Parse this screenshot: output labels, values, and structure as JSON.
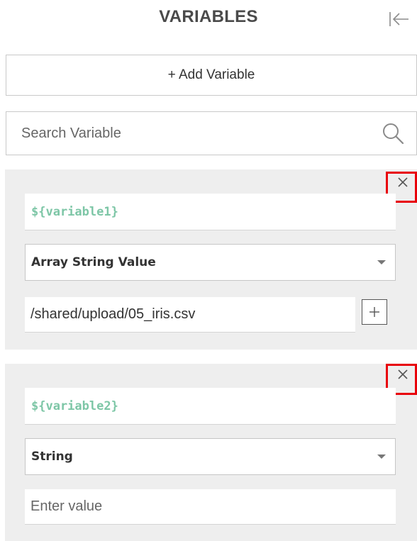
{
  "header": {
    "title": "VARIABLES",
    "collapse_icon": "collapse-left-icon"
  },
  "toolbar": {
    "add_label": "+ Add Variable"
  },
  "search": {
    "placeholder": "Search Variable",
    "value": "",
    "icon": "search-icon"
  },
  "variables": [
    {
      "name": "${variable1}",
      "type": "Array String Value",
      "value": "/shared/upload/05_iris.csv",
      "placeholder": "",
      "has_add_value": true
    },
    {
      "name": "${variable2}",
      "type": "String",
      "value": "",
      "placeholder": "Enter value",
      "has_add_value": false
    }
  ],
  "colors": {
    "variable_name": "#7dc6a6",
    "close_highlight": "#e8000b",
    "card_background": "#eeeeee"
  }
}
